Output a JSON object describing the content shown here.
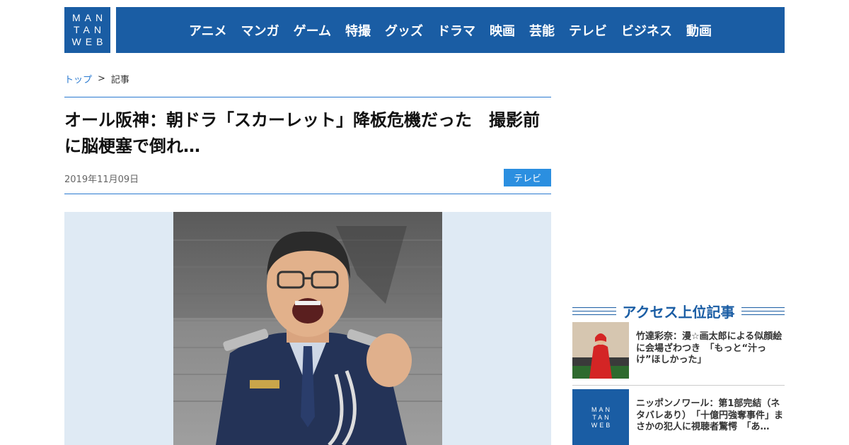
{
  "logo": {
    "lines": [
      "MAN",
      "TAN",
      "WEB"
    ]
  },
  "nav": [
    "アニメ",
    "マンガ",
    "ゲーム",
    "特撮",
    "グッズ",
    "ドラマ",
    "映画",
    "芸能",
    "テレビ",
    "ビジネス",
    "動画"
  ],
  "breadcrumb": {
    "home": "トップ",
    "separator": ">",
    "current": "記事"
  },
  "article": {
    "title": "オール阪神：朝ドラ「スカーレット」降板危機だった　撮影前に脳梗塞で倒れ…",
    "date": "2019年11月09日",
    "category": "テレビ"
  },
  "sidebar": {
    "heading": "アクセス上位記事",
    "items": [
      {
        "text": "竹達彩奈：漫☆画太郎による似顔絵に会場ざわつき　「もっと“汁っけ”ほしかった」"
      },
      {
        "text": "ニッポンノワール：第1部完結（ネタバレあり）　「十億円強奪事件」まさかの犯人に視聴者驚愕　「あ…"
      }
    ]
  },
  "colors": {
    "brand": "#1a5da4",
    "accent": "#2b8fe0",
    "link": "#2a7ad0"
  }
}
